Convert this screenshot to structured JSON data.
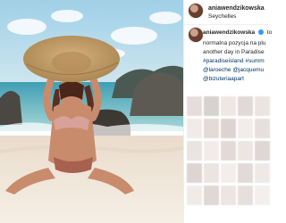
{
  "post": {
    "username": "aniawendzikowska",
    "location": "Seychelles",
    "caption_user": "aniawendzikowska",
    "caption_lines": [
      "to",
      "normalna pozycja na plu",
      "another day in Paradise",
      "#paradiseisland #summ",
      "@laroeche @jacquemu",
      "@bizuteriaapart"
    ]
  },
  "colors": {
    "sky": "#8fc3dd",
    "sea": "#6fb2bf",
    "sand": "#f0e7dc",
    "hashtag": "#003569"
  },
  "icons": {
    "verified": "verified-badge-icon",
    "photo": "post-photo",
    "avatar": "avatar"
  }
}
